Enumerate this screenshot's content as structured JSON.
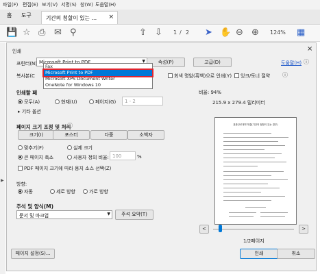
{
  "menu": [
    "파일(F)",
    "편집(E)",
    "보기(V)",
    "서명(S)",
    "창(W)",
    "도움말(H)"
  ],
  "tabs": {
    "home": "홈",
    "tools": "도구",
    "document": "기간의 청할이 있는 ..."
  },
  "toolbar": {
    "page_current": "1",
    "page_sep": "/",
    "page_total": "2",
    "zoom": "124%"
  },
  "dialog": {
    "title": "인쇄",
    "printer_label": "프린터(N):",
    "printer_value": "Microsoft Print to PDF",
    "properties_button": "속성(P)",
    "advanced_button": "고급(D)",
    "help_link": "도움말(H)",
    "copies_label": "복사본(C",
    "grayscale_label": "회색 명암(흑백)으로 인쇄(Y)",
    "ink_saver_label": "잉크/토너 절약",
    "printer_options": [
      "Fax",
      "Microsoft Print to PDF",
      "Microsoft XPS Document Writer",
      "OneNote for Windows 10"
    ],
    "range_header": "인쇄할 페",
    "range_all": "모두(A)",
    "range_current": "현재(U)",
    "range_pages": "페이지(G)",
    "range_pages_value": "1 - 2",
    "more_options": "기타 옵션",
    "sizing_header": "페이지 크기 조정 및 처리",
    "size_button": "크기(I)",
    "poster_button": "포스터",
    "multiple_button": "다중",
    "booklet_button": "소책자",
    "fit_label": "맞추기(F)",
    "actual_label": "실제 크기",
    "shrink_label": "큰 페이지 축소",
    "custom_label": "사용자 정의 비율:",
    "custom_value": "100",
    "percent": "%",
    "pdf_paper_label": "PDF 페이지 크기에 따라 용지 소스 선택(Z)",
    "orientation_header": "방향:",
    "orient_auto": "자동",
    "orient_portrait": "세로 방향",
    "orient_landscape": "가로 방향",
    "comments_header": "주석 및 양식(M)",
    "comments_value": "문서 및 마크업",
    "summarize_button": "주석 요약(T)",
    "page_setup_button": "페이지 설정(S)...",
    "print_button": "인쇄",
    "cancel_button": "취소"
  },
  "preview": {
    "scale_label": "비율: 94%",
    "paper_size": "215.9 x 279.4 밀리미터",
    "doc_heading": "표준근로계약 체결(기간의 정함이 있는 경우)",
    "page_indicator": "1/2페이지",
    "prev": "<",
    "next": ">"
  },
  "colors": {
    "accent": "#0078d7",
    "highlight_border": "#e0242f"
  }
}
